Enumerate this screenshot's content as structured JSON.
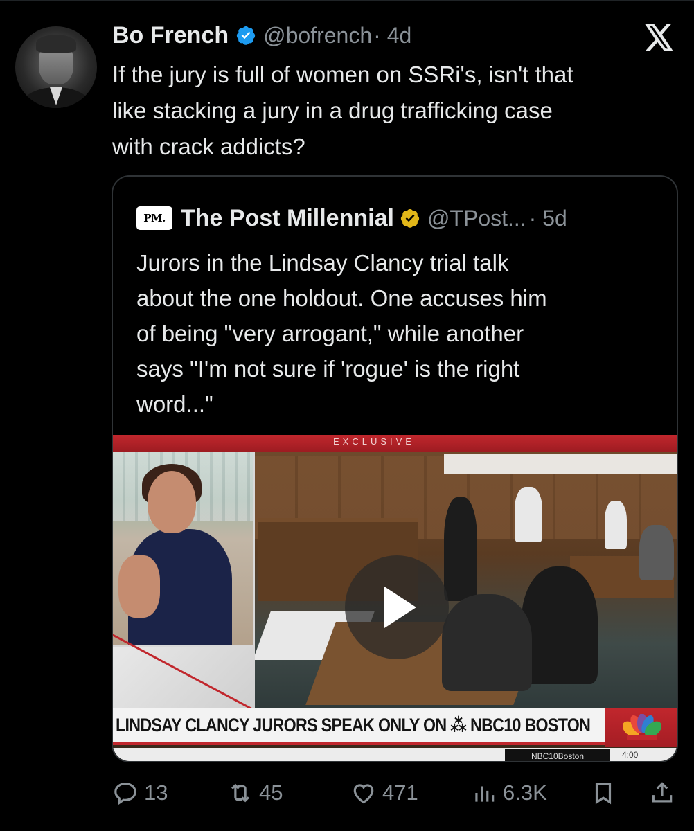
{
  "tweet": {
    "author_name": "Bo French",
    "author_handle": "@bofrench",
    "age": "· 4d",
    "text": "If the jury is full of women on SSRi's, isn't that\nlike stacking a jury in a drug trafficking case\nwith crack addicts?"
  },
  "quoted": {
    "logo_text": "PM.",
    "author_name": "The Post Millennial",
    "author_handle": "@TPost...",
    "age": "· 5d",
    "text": "Jurors in the Lindsay Clancy trial talk\nabout the one holdout. One accuses him\nof being \"very arrogant,\" while another\nsays \"I'm not sure if 'rogue' is the right\nword...\"",
    "video": {
      "top_label": "EXCLUSIVE",
      "lower_third": "LINDSAY CLANCY JURORS SPEAK ONLY ON ⁂ NBC10 BOSTON",
      "ticker_handle": "NBC10Boston",
      "ticker_time": "4:00"
    }
  },
  "actions": {
    "replies": "13",
    "reposts": "45",
    "likes": "471",
    "views": "6.3K"
  },
  "colors": {
    "background": "#000000",
    "text": "#e7e9ea",
    "muted": "#8b9298",
    "verified_blue": "#1d9bf0",
    "verified_gold": "#e2b719",
    "border": "#2f3336"
  },
  "icons": [
    "x-logo-icon",
    "verified-badge-icon",
    "gold-verified-badge-icon",
    "play-icon",
    "reply-icon",
    "repost-icon",
    "like-icon",
    "views-icon",
    "bookmark-icon",
    "share-icon",
    "nbc-peacock-icon"
  ]
}
